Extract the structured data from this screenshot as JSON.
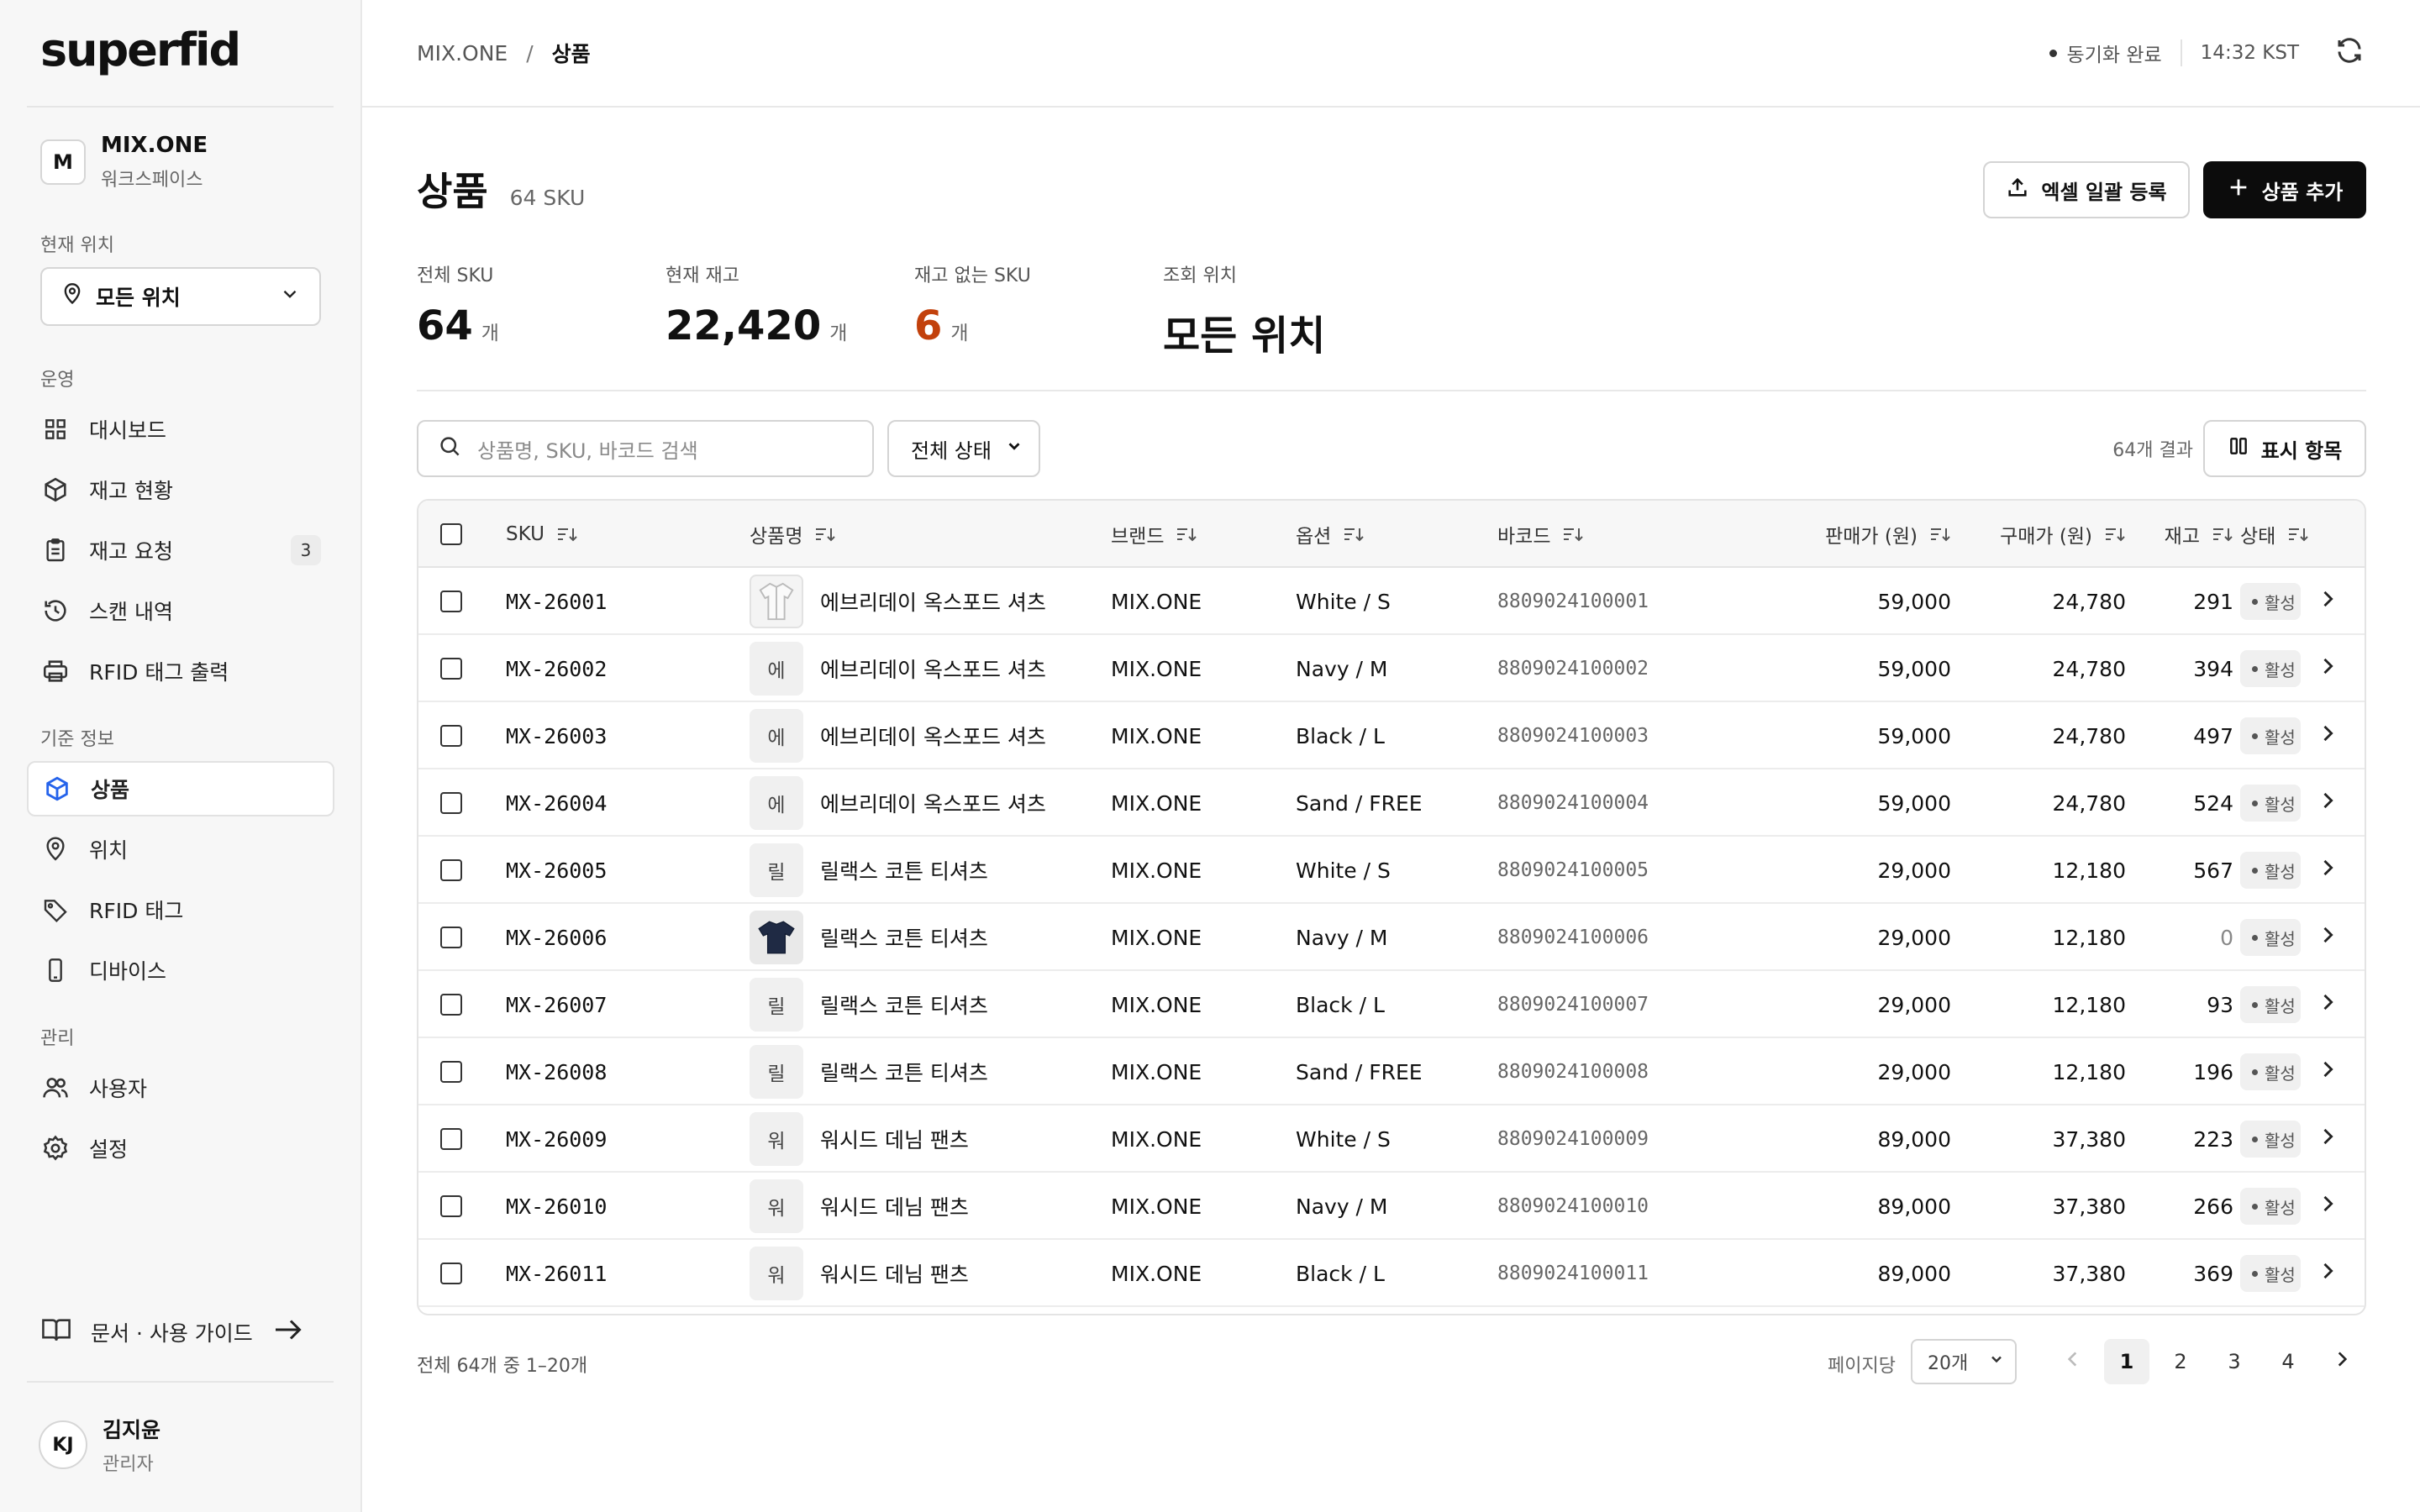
{
  "app": {
    "logo": "superfid"
  },
  "workspace": {
    "initial": "M",
    "name": "MIX.ONE",
    "subtitle": "워크스페이스"
  },
  "location": {
    "label": "현재 위치",
    "selected": "모든 위치"
  },
  "sidebar": {
    "section_ops": "운영",
    "ops_items": [
      {
        "label": "대시보드",
        "icon": "grid-icon"
      },
      {
        "label": "재고 현황",
        "icon": "box-icon"
      },
      {
        "label": "재고 요청",
        "icon": "clipboard-icon",
        "badge": "3"
      },
      {
        "label": "스캔 내역",
        "icon": "history-icon"
      },
      {
        "label": "RFID 태그 출력",
        "icon": "printer-icon"
      }
    ],
    "section_master": "기준 정보",
    "master_items": [
      {
        "label": "상품",
        "icon": "box-icon",
        "active": true
      },
      {
        "label": "위치",
        "icon": "map-pin-icon"
      },
      {
        "label": "RFID 태그",
        "icon": "tag-icon"
      },
      {
        "label": "디바이스",
        "icon": "device-icon"
      }
    ],
    "section_admin": "관리",
    "admin_items": [
      {
        "label": "사용자",
        "icon": "users-icon"
      },
      {
        "label": "설정",
        "icon": "gear-icon"
      }
    ],
    "guide_label": "문서 · 사용 가이드"
  },
  "user": {
    "initials": "KJ",
    "name": "김지윤",
    "role": "관리자"
  },
  "topbar": {
    "breadcrumb_root": "MIX.ONE",
    "breadcrumb_sep": "/",
    "breadcrumb_current": "상품",
    "sync_status": "동기화 완료",
    "time": "14:32 KST"
  },
  "page": {
    "title": "상품",
    "count": "64 SKU",
    "excel_button": "엑셀 일괄 등록",
    "add_button": "상품 추가"
  },
  "stats": [
    {
      "label": "전체 SKU",
      "value": "64",
      "unit": "개"
    },
    {
      "label": "현재 재고",
      "value": "22,420",
      "unit": "개"
    },
    {
      "label": "재고 없는 SKU",
      "value": "6",
      "unit": "개"
    },
    {
      "label": "조회 위치",
      "value": "모든 위치",
      "unit": ""
    }
  ],
  "toolbar": {
    "search_placeholder": "상품명, SKU, 바코드 검색",
    "status_filter": "전체 상태",
    "results": "64개 결과",
    "columns_button": "표시 항목"
  },
  "table": {
    "headers": {
      "sku": "SKU",
      "name": "상품명",
      "brand": "브랜드",
      "option": "옵션",
      "barcode": "바코드",
      "price": "판매가 (원)",
      "cost": "구매가 (원)",
      "stock": "재고",
      "status": "상태"
    },
    "rows": [
      {
        "sku": "MX-26001",
        "thumb": "",
        "name": "에브리데이 옥스포드 셔츠",
        "brand": "MIX.ONE",
        "option": "White / S",
        "barcode": "8809024100001",
        "price": "59,000",
        "cost": "24,780",
        "stock": "291",
        "status": "활성"
      },
      {
        "sku": "MX-26002",
        "thumb": "에",
        "name": "에브리데이 옥스포드 셔츠",
        "brand": "MIX.ONE",
        "option": "Navy / M",
        "barcode": "8809024100002",
        "price": "59,000",
        "cost": "24,780",
        "stock": "394",
        "status": "활성"
      },
      {
        "sku": "MX-26003",
        "thumb": "에",
        "name": "에브리데이 옥스포드 셔츠",
        "brand": "MIX.ONE",
        "option": "Black / L",
        "barcode": "8809024100003",
        "price": "59,000",
        "cost": "24,780",
        "stock": "497",
        "status": "활성"
      },
      {
        "sku": "MX-26004",
        "thumb": "에",
        "name": "에브리데이 옥스포드 셔츠",
        "brand": "MIX.ONE",
        "option": "Sand / FREE",
        "barcode": "8809024100004",
        "price": "59,000",
        "cost": "24,780",
        "stock": "524",
        "status": "활성"
      },
      {
        "sku": "MX-26005",
        "thumb": "릴",
        "name": "릴랙스 코튼 티셔츠",
        "brand": "MIX.ONE",
        "option": "White / S",
        "barcode": "8809024100005",
        "price": "29,000",
        "cost": "12,180",
        "stock": "567",
        "status": "활성"
      },
      {
        "sku": "MX-26006",
        "thumb": "",
        "name": "릴랙스 코튼 티셔츠",
        "brand": "MIX.ONE",
        "option": "Navy / M",
        "barcode": "8809024100006",
        "price": "29,000",
        "cost": "12,180",
        "stock": "0",
        "status": "활성"
      },
      {
        "sku": "MX-26007",
        "thumb": "릴",
        "name": "릴랙스 코튼 티셔츠",
        "brand": "MIX.ONE",
        "option": "Black / L",
        "barcode": "8809024100007",
        "price": "29,000",
        "cost": "12,180",
        "stock": "93",
        "status": "활성"
      },
      {
        "sku": "MX-26008",
        "thumb": "릴",
        "name": "릴랙스 코튼 티셔츠",
        "brand": "MIX.ONE",
        "option": "Sand / FREE",
        "barcode": "8809024100008",
        "price": "29,000",
        "cost": "12,180",
        "stock": "196",
        "status": "활성"
      },
      {
        "sku": "MX-26009",
        "thumb": "워",
        "name": "워시드 데님 팬츠",
        "brand": "MIX.ONE",
        "option": "White / S",
        "barcode": "8809024100009",
        "price": "89,000",
        "cost": "37,380",
        "stock": "223",
        "status": "활성"
      },
      {
        "sku": "MX-26010",
        "thumb": "워",
        "name": "워시드 데님 팬츠",
        "brand": "MIX.ONE",
        "option": "Navy / M",
        "barcode": "8809024100010",
        "price": "89,000",
        "cost": "37,380",
        "stock": "266",
        "status": "활성"
      },
      {
        "sku": "MX-26011",
        "thumb": "워",
        "name": "워시드 데님 팬츠",
        "brand": "MIX.ONE",
        "option": "Black / L",
        "barcode": "8809024100011",
        "price": "89,000",
        "cost": "37,380",
        "stock": "369",
        "status": "활성"
      }
    ]
  },
  "footer": {
    "range": "전체 64개 중 1–20개",
    "per_page_label": "페이지당",
    "per_page_value": "20개",
    "pages": [
      "1",
      "2",
      "3",
      "4"
    ],
    "current_page": "1"
  },
  "colors": {
    "accent_dark": "#0c0c0c",
    "warning": "#c2410c",
    "active_icon": "#2563eb"
  }
}
